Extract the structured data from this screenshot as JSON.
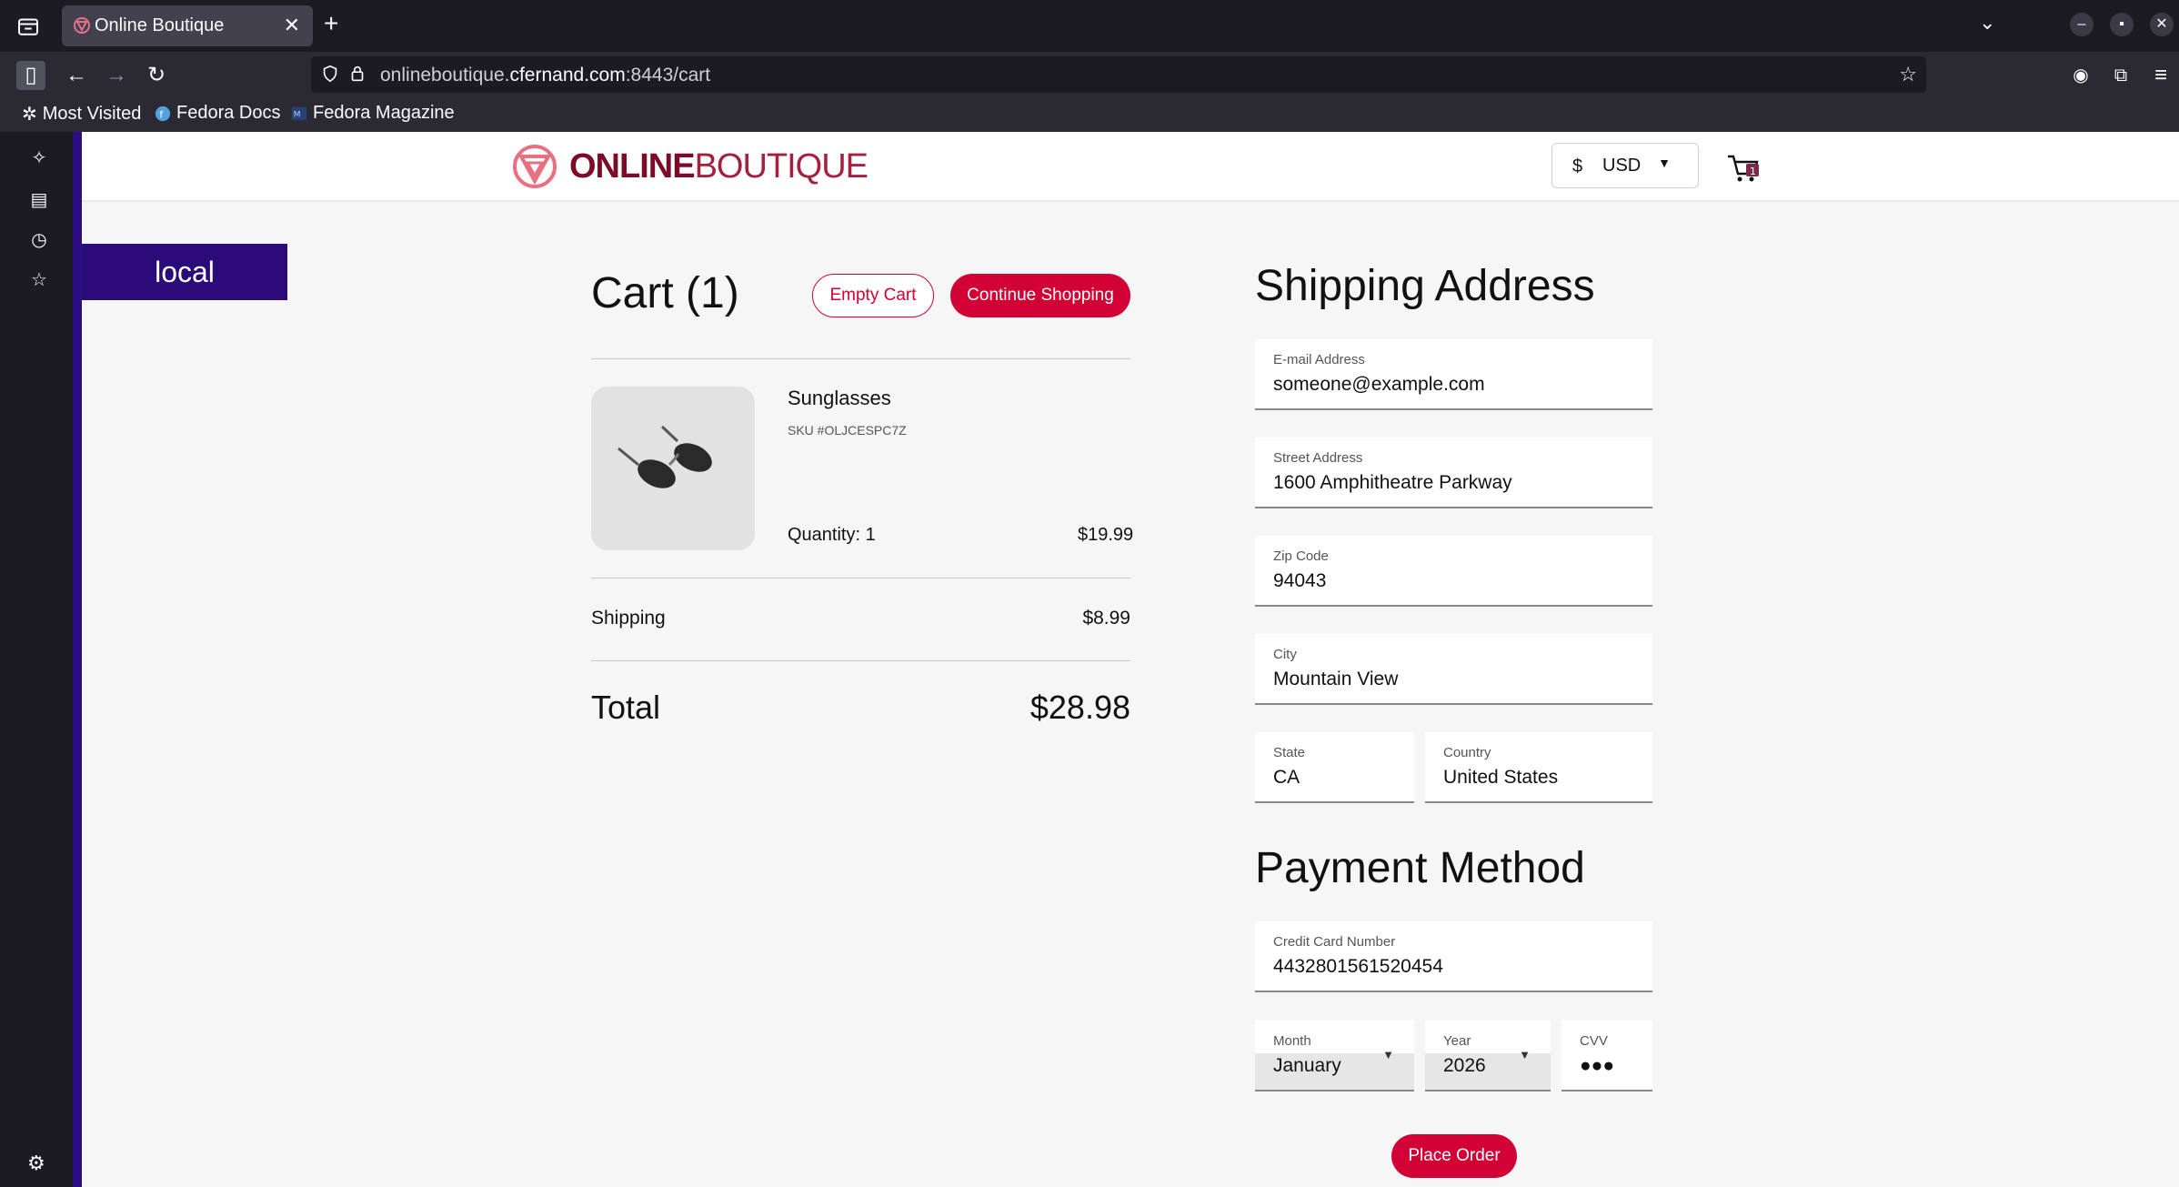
{
  "browser": {
    "tab_title": "Online Boutique",
    "url_prefix": "onlineboutique.",
    "url_host": "cfernand.com",
    "url_suffix": ":8443/cart",
    "bookmarks": [
      "Most Visited",
      "Fedora Docs",
      "Fedora Magazine"
    ]
  },
  "header": {
    "logo_online": "ONLINE",
    "logo_boutique": "BOUTIQUE",
    "currency_symbol": "$",
    "currency_code": "USD",
    "cart_count": "1"
  },
  "env_badge": "local",
  "cart": {
    "title": "Cart (1)",
    "empty_label": "Empty Cart",
    "continue_label": "Continue Shopping",
    "item": {
      "name": "Sunglasses",
      "sku": "SKU #OLJCESPC7Z",
      "quantity": "Quantity: 1",
      "price": "$19.99"
    },
    "shipping_label": "Shipping",
    "shipping_value": "$8.99",
    "total_label": "Total",
    "total_value": "$28.98"
  },
  "shipping": {
    "title": "Shipping Address",
    "email_label": "E-mail Address",
    "email": "someone@example.com",
    "street_label": "Street Address",
    "street": "1600 Amphitheatre Parkway",
    "zip_label": "Zip Code",
    "zip": "94043",
    "city_label": "City",
    "city": "Mountain View",
    "state_label": "State",
    "state": "CA",
    "country_label": "Country",
    "country": "United States"
  },
  "payment": {
    "title": "Payment Method",
    "cc_label": "Credit Card Number",
    "cc": "4432801561520454",
    "month_label": "Month",
    "month": "January",
    "year_label": "Year",
    "year": "2026",
    "cvv_label": "CVV",
    "cvv": "●●●",
    "place_order": "Place Order"
  },
  "colors": {
    "accent": "#d20135",
    "env_badge_bg": "#2b0a7a"
  }
}
